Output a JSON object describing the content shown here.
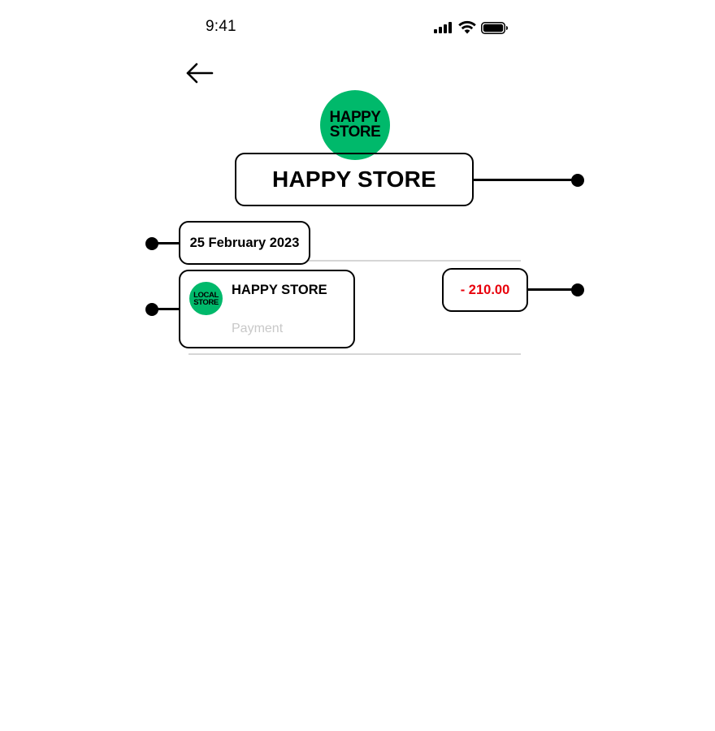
{
  "status_bar": {
    "time": "9:41"
  },
  "header": {
    "logo_line1": "HAPPY",
    "logo_line2": "STORE",
    "store_name": "HAPPY STORE"
  },
  "transaction": {
    "date": "25 February 2023",
    "merchant_logo_line1": "LOCAL",
    "merchant_logo_line2": "STORE",
    "merchant_name": "HAPPY STORE",
    "type": "Payment",
    "amount": "- 210.00"
  },
  "colors": {
    "brand_green": "#00b96b",
    "amount_negative": "#e8000b",
    "muted_text": "#c8c8c8"
  },
  "icons": {
    "back": "arrow-left-icon",
    "signal": "cellular-signal-icon",
    "wifi": "wifi-icon",
    "battery": "battery-icon"
  }
}
